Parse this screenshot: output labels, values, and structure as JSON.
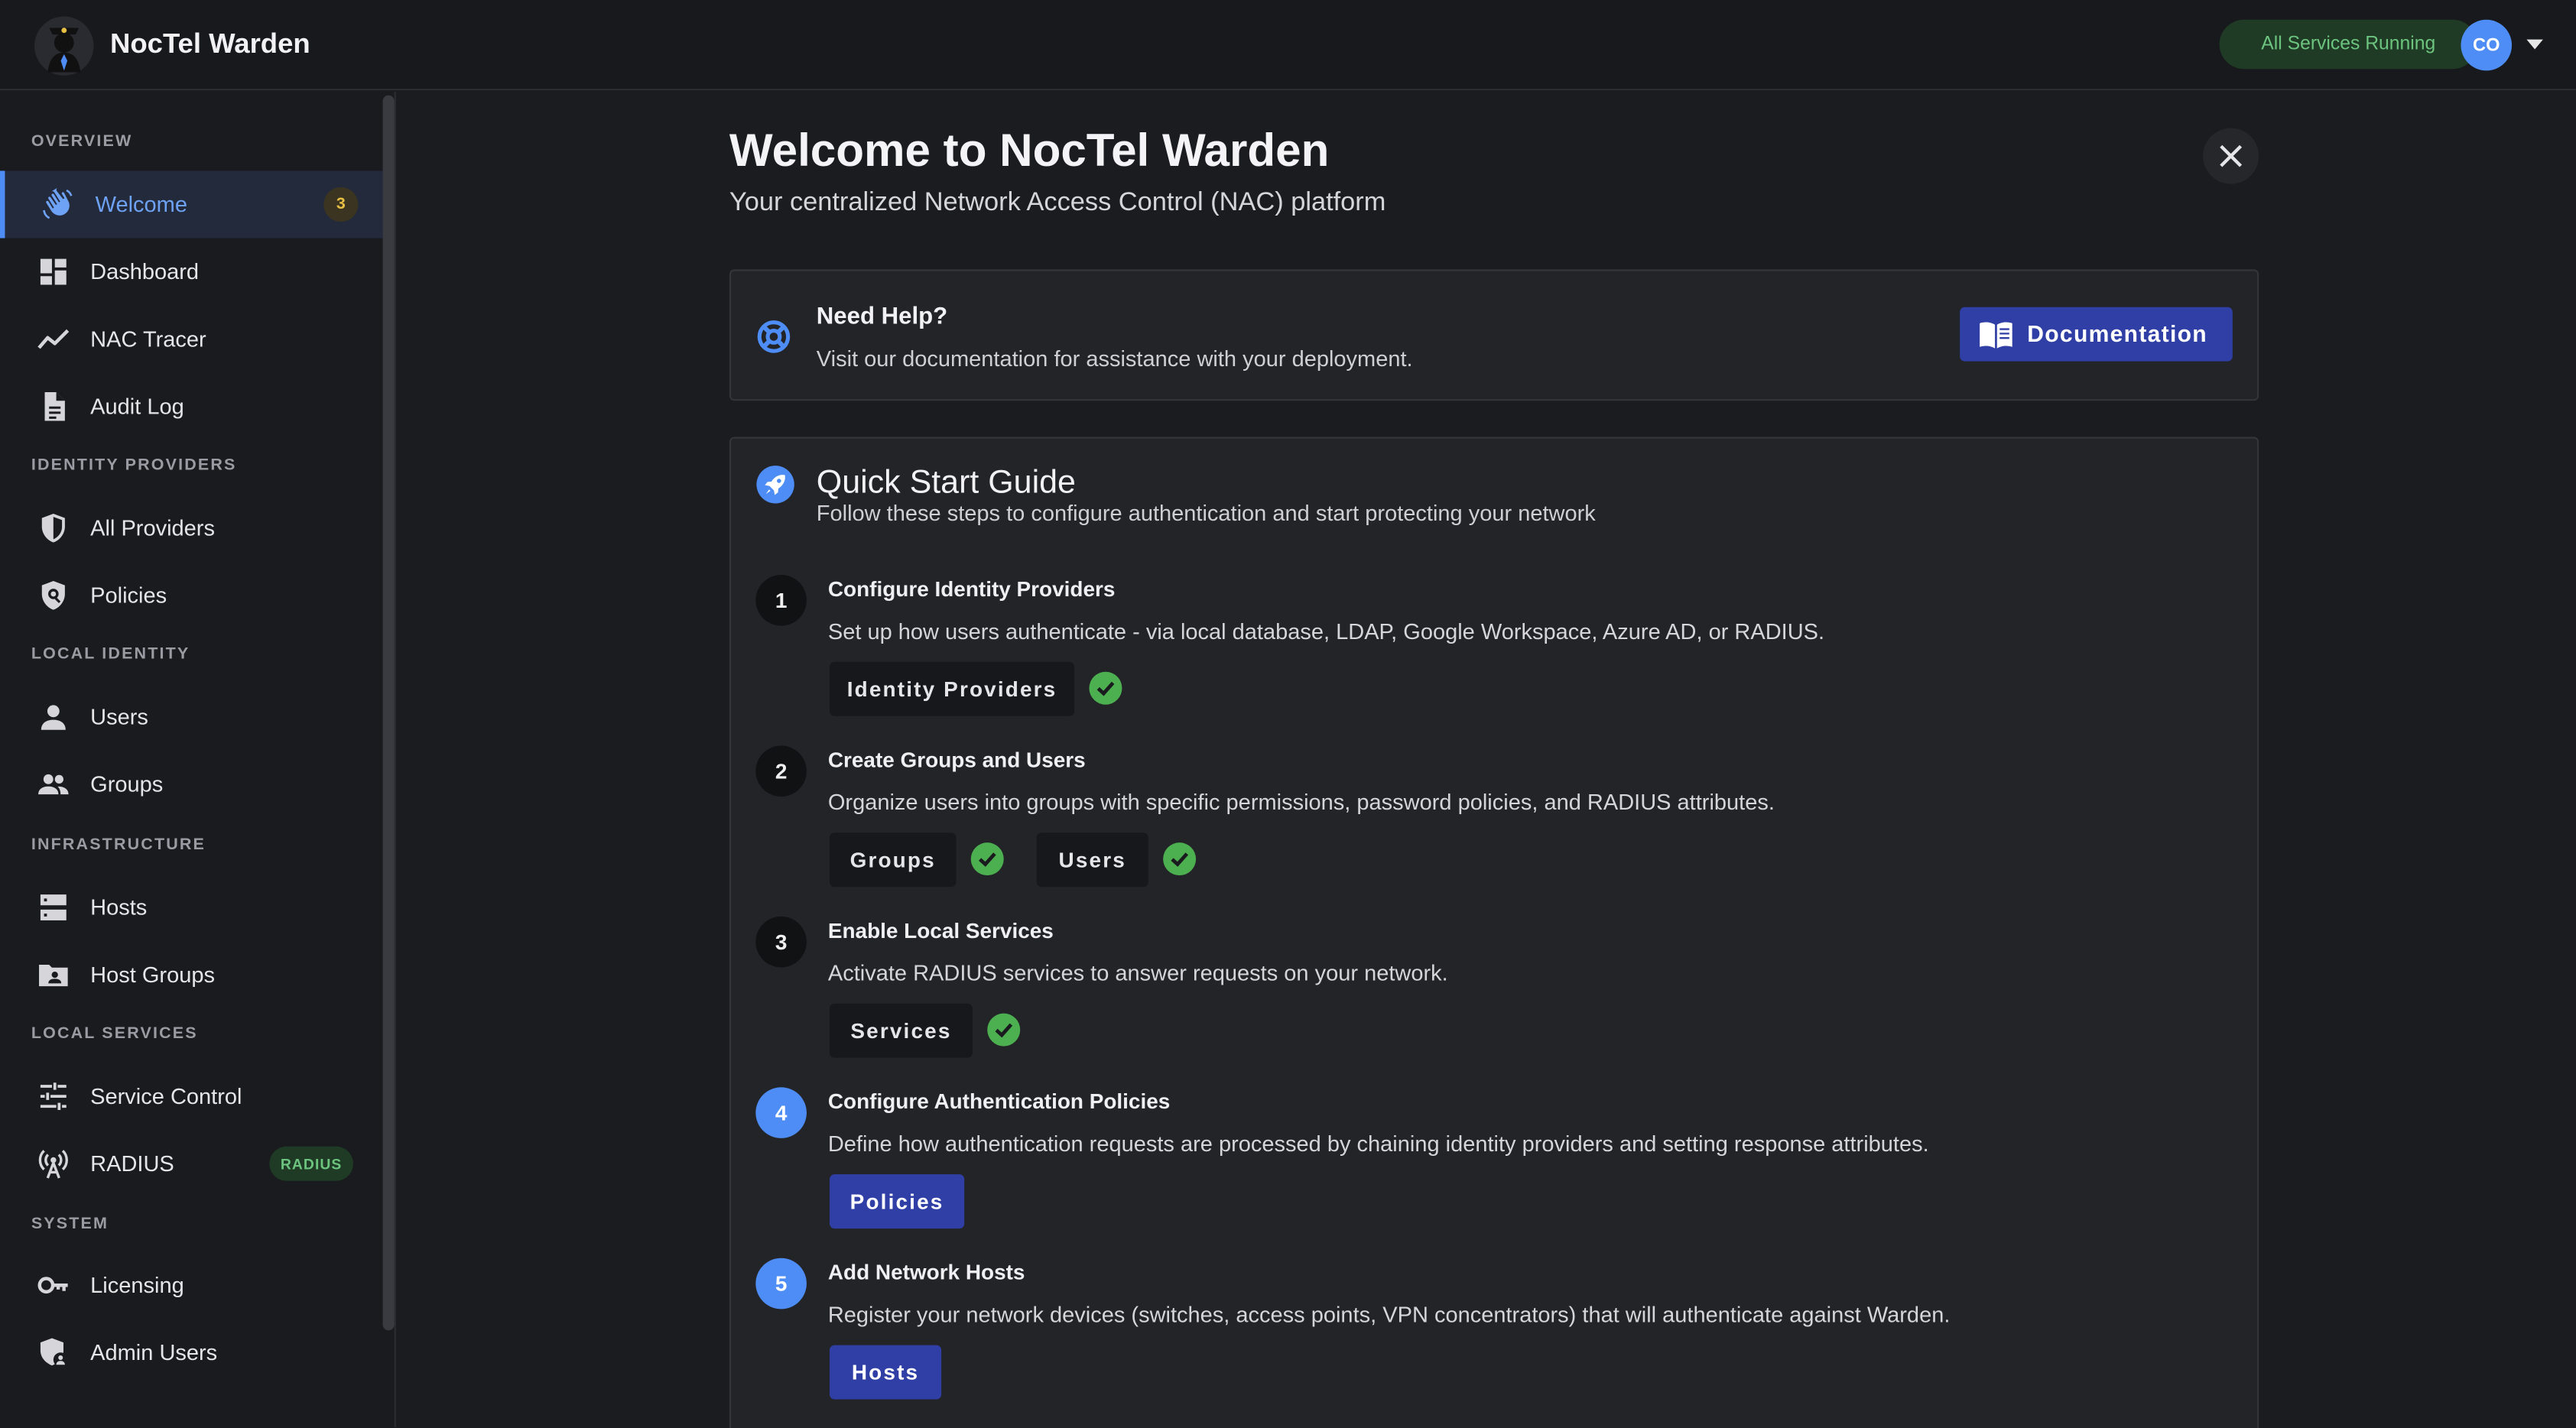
{
  "app": {
    "title": "NocTel Warden"
  },
  "header": {
    "status": "All Services Running",
    "avatar_initials": "CO"
  },
  "sidebar": {
    "sections": {
      "overview": "OVERVIEW",
      "identity_providers": "IDENTITY PROVIDERS",
      "local_identity": "LOCAL IDENTITY",
      "infrastructure": "INFRASTRUCTURE",
      "local_services": "LOCAL SERVICES",
      "system": "SYSTEM"
    },
    "items": {
      "welcome": {
        "label": "Welcome",
        "badge": "3",
        "icon": "wave-hand-icon"
      },
      "dashboard": {
        "label": "Dashboard",
        "icon": "dashboard-icon"
      },
      "nac_tracer": {
        "label": "NAC Tracer",
        "icon": "trend-line-icon"
      },
      "audit_log": {
        "label": "Audit Log",
        "icon": "document-icon"
      },
      "all_providers": {
        "label": "All Providers",
        "icon": "shield-icon"
      },
      "policies": {
        "label": "Policies",
        "icon": "policy-shield-icon"
      },
      "users": {
        "label": "Users",
        "icon": "person-icon"
      },
      "groups": {
        "label": "Groups",
        "icon": "people-icon"
      },
      "hosts": {
        "label": "Hosts",
        "icon": "server-icon"
      },
      "host_groups": {
        "label": "Host Groups",
        "icon": "folder-person-icon"
      },
      "service_control": {
        "label": "Service Control",
        "icon": "sliders-icon"
      },
      "radius": {
        "label": "RADIUS",
        "badge": "RADIUS",
        "icon": "antenna-icon"
      },
      "licensing": {
        "label": "Licensing",
        "icon": "key-icon"
      },
      "admin_users": {
        "label": "Admin Users",
        "icon": "admin-user-icon"
      }
    }
  },
  "main": {
    "title": "Welcome to NocTel Warden",
    "subtitle": "Your centralized Network Access Control (NAC) platform",
    "help": {
      "title": "Need Help?",
      "text": "Visit our documentation for assistance with your deployment.",
      "button": "Documentation"
    },
    "quick_start": {
      "title": "Quick Start Guide",
      "subtitle": "Follow these steps to configure authentication and start protecting your network",
      "steps": [
        {
          "number": "1",
          "title": "Configure Identity Providers",
          "text": "Set up how users authenticate - via local database, LDAP, Google Workspace, Azure AD, or RADIUS.",
          "buttons": [
            "Identity Providers"
          ]
        },
        {
          "number": "2",
          "title": "Create Groups and Users",
          "text": "Organize users into groups with specific permissions, password policies, and RADIUS attributes.",
          "buttons": [
            "Groups",
            "Users"
          ]
        },
        {
          "number": "3",
          "title": "Enable Local Services",
          "text": "Activate RADIUS services to answer requests on your network.",
          "buttons": [
            "Services"
          ]
        },
        {
          "number": "4",
          "title": "Configure Authentication Policies",
          "text": "Define how authentication requests are processed by chaining identity providers and setting response attributes.",
          "buttons": [
            "Policies"
          ]
        },
        {
          "number": "5",
          "title": "Add Network Hosts",
          "text": "Register your network devices (switches, access points, VPN concentrators) that will authenticate against Warden.",
          "buttons": [
            "Hosts"
          ]
        }
      ]
    }
  },
  "colors": {
    "accent": "#4e8df5",
    "button_blue": "#2f3fa6",
    "success": "#4caf50",
    "status_green": "#6cc47f"
  }
}
